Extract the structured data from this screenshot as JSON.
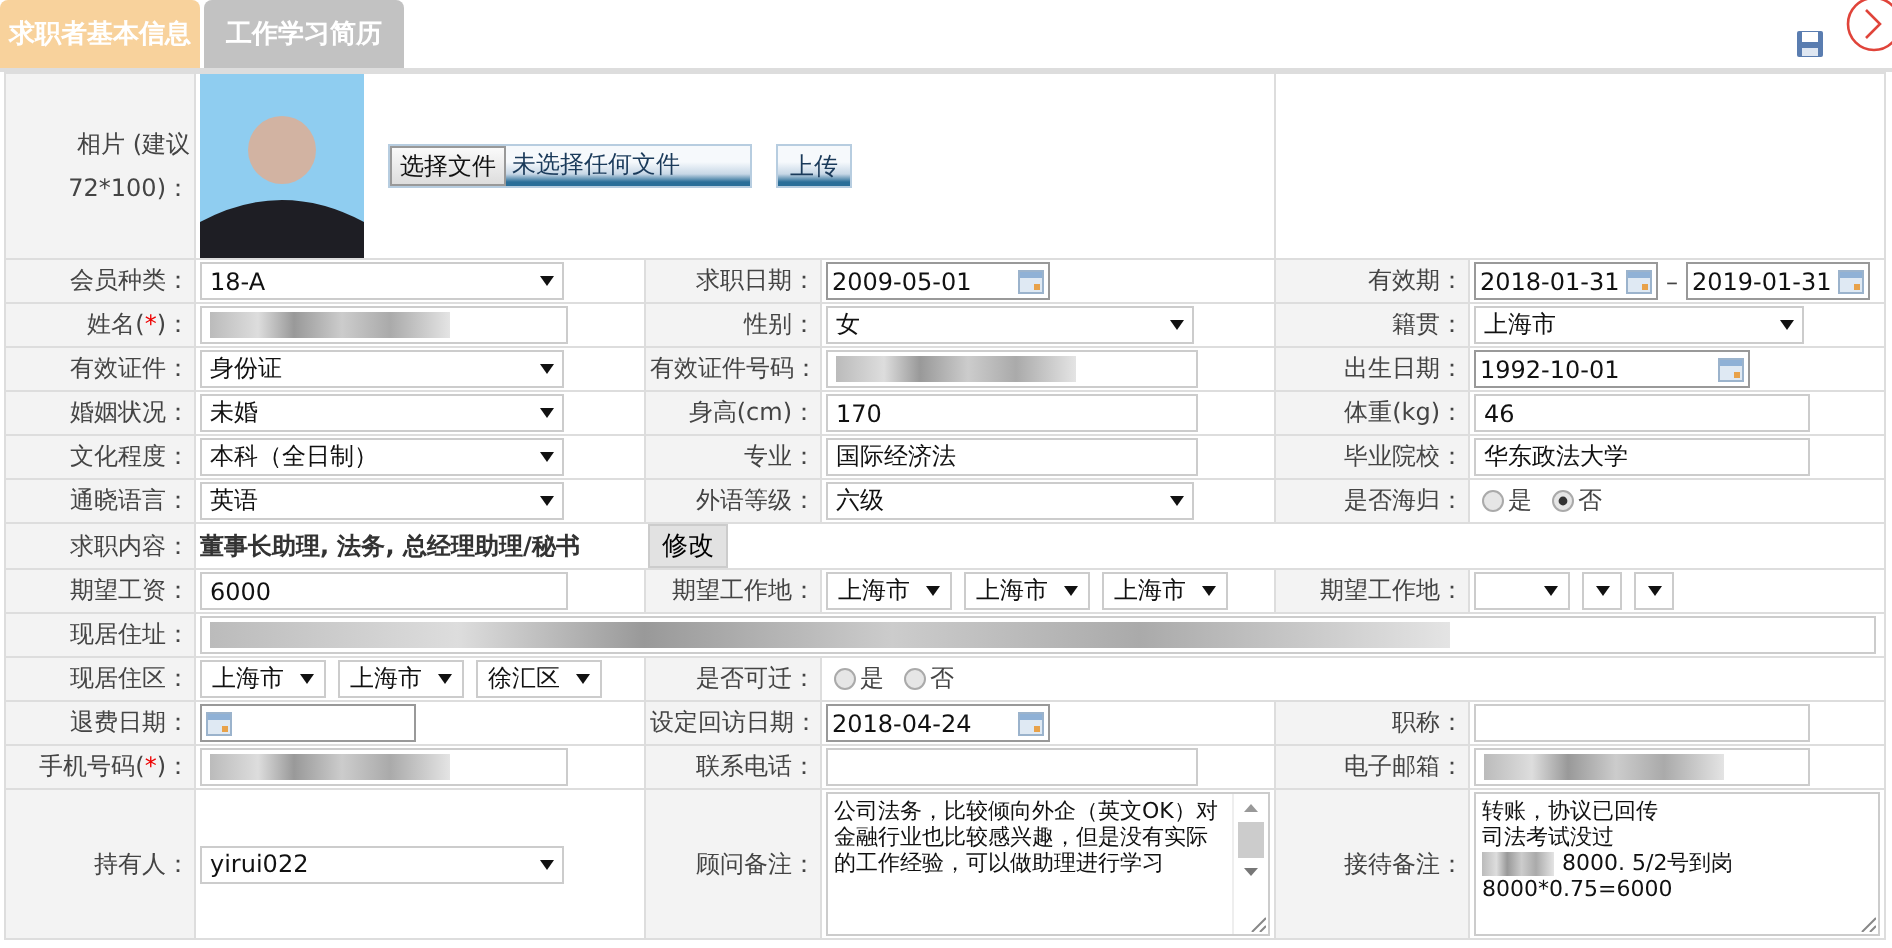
{
  "tabs": [
    {
      "label": "求职者基本信息",
      "selected": true
    },
    {
      "label": "工作学习简历",
      "selected": false
    }
  ],
  "photo_row": {
    "label": "相片 (建议72*100)：",
    "choose_button": "选择文件",
    "file_status": "未选择任何文件",
    "upload_button": "上传"
  },
  "rows": [
    [
      {
        "label": "会员种类：",
        "field": {
          "kind": "select",
          "value": "18-A"
        }
      },
      {
        "label": "求职日期：",
        "field": {
          "kind": "date",
          "value": "2009-05-01"
        }
      },
      {
        "label": "有效期：",
        "field": {
          "kind": "date-range",
          "from": "2018-01-31",
          "separator": "–",
          "to": "2019-01-31"
        }
      }
    ],
    [
      {
        "label": "姓名(",
        "required_mark": "*",
        "label_end": ")：",
        "field": {
          "kind": "redacted"
        }
      },
      {
        "label": "性别：",
        "field": {
          "kind": "select",
          "value": "女"
        }
      },
      {
        "label": "籍贯：",
        "field": {
          "kind": "select",
          "value": "上海市"
        }
      }
    ],
    [
      {
        "label": "有效证件：",
        "field": {
          "kind": "select",
          "value": "身份证"
        }
      },
      {
        "label": "有效证件号码：",
        "field": {
          "kind": "redacted"
        }
      },
      {
        "label": "出生日期：",
        "field": {
          "kind": "date",
          "value": "1992-10-01"
        }
      }
    ],
    [
      {
        "label": "婚姻状况：",
        "field": {
          "kind": "select",
          "value": "未婚"
        }
      },
      {
        "label": "身高(cm)：",
        "field": {
          "kind": "text",
          "value": "170"
        }
      },
      {
        "label": "体重(kg)：",
        "field": {
          "kind": "text",
          "value": "46"
        }
      }
    ],
    [
      {
        "label": "文化程度：",
        "field": {
          "kind": "select",
          "value": "本科（全日制）"
        }
      },
      {
        "label": "专业：",
        "field": {
          "kind": "text",
          "value": " 国际经济法"
        }
      },
      {
        "label": "毕业院校：",
        "field": {
          "kind": "text",
          "value": "华东政法大学"
        }
      }
    ],
    [
      {
        "label": "通晓语言：",
        "field": {
          "kind": "select",
          "value": "英语"
        }
      },
      {
        "label": "外语等级：",
        "field": {
          "kind": "select",
          "value": "六级"
        }
      },
      {
        "label": "是否海归：",
        "field": {
          "kind": "radio",
          "options": [
            {
              "label": "是",
              "selected": false
            },
            {
              "label": "否",
              "selected": true
            }
          ]
        }
      }
    ],
    [
      {
        "label": "求职内容：",
        "field": {
          "kind": "text-with-button",
          "value": "董事长助理, 法务, 总经理助理/秘书",
          "button": "修改"
        }
      }
    ],
    [
      {
        "label": "期望工资：",
        "field": {
          "kind": "text",
          "value": "6000"
        }
      },
      {
        "label": "期望工作地：",
        "field": {
          "kind": "select-group",
          "selects": [
            {
              "value": "上海市"
            },
            {
              "value": "上海市"
            },
            {
              "value": "上海市"
            }
          ]
        }
      },
      {
        "label": "期望工作地：",
        "field": {
          "kind": "select-group",
          "selects": [
            {
              "blank": true
            },
            {
              "blank": true
            },
            {
              "blank": true
            }
          ]
        }
      }
    ],
    [
      {
        "label": "现居住址：",
        "field": {
          "kind": "redacted"
        }
      }
    ],
    [
      {
        "label": "现居住区：",
        "field": {
          "kind": "select-group",
          "selects": [
            {
              "value": "上海市"
            },
            {
              "value": "上海市"
            },
            {
              "value": "徐汇区"
            }
          ]
        }
      },
      {
        "label": "是否可迁：",
        "field": {
          "kind": "radio",
          "options": [
            {
              "label": "是",
              "selected": false
            },
            {
              "label": "否",
              "selected": false
            }
          ]
        }
      }
    ],
    [
      {
        "label": "退费日期：",
        "field": {
          "kind": "date"
        }
      },
      {
        "label": "设定回访日期：",
        "field": {
          "kind": "date",
          "value": "2018-04-24"
        }
      },
      {
        "label": "职称：",
        "field": {
          "kind": "text"
        }
      }
    ],
    [
      {
        "label": "手机号码(",
        "required_mark": "*",
        "label_end": ")：",
        "field": {
          "kind": "redacted"
        }
      },
      {
        "label": "联系电话：",
        "field": {
          "kind": "text"
        }
      },
      {
        "label": "电子邮箱：",
        "field": {
          "kind": "redacted"
        }
      }
    ],
    [
      {
        "label": "持有人：",
        "field": {
          "kind": "select",
          "value": "yirui022"
        }
      },
      {
        "label": "顾问备注：",
        "field": {
          "kind": "textarea",
          "scrollbar": true,
          "lines": [
            {
              "text": "公司法务，比较倾向外企（英文OK）对金融行业也比较感兴趣，但是没有实际的工作经验，可以做助理进行学习"
            }
          ]
        }
      },
      {
        "label": "接待备注：",
        "field": {
          "kind": "textarea",
          "scrollbar": false,
          "lines": [
            {
              "text": "转账，协议已回传"
            },
            {
              "text": "司法考试没过"
            },
            {
              "text": "8000. 5/2号到岗",
              "redacted_prefix": true
            },
            {
              "text": "8000*0.75=6000"
            }
          ]
        }
      }
    ]
  ]
}
